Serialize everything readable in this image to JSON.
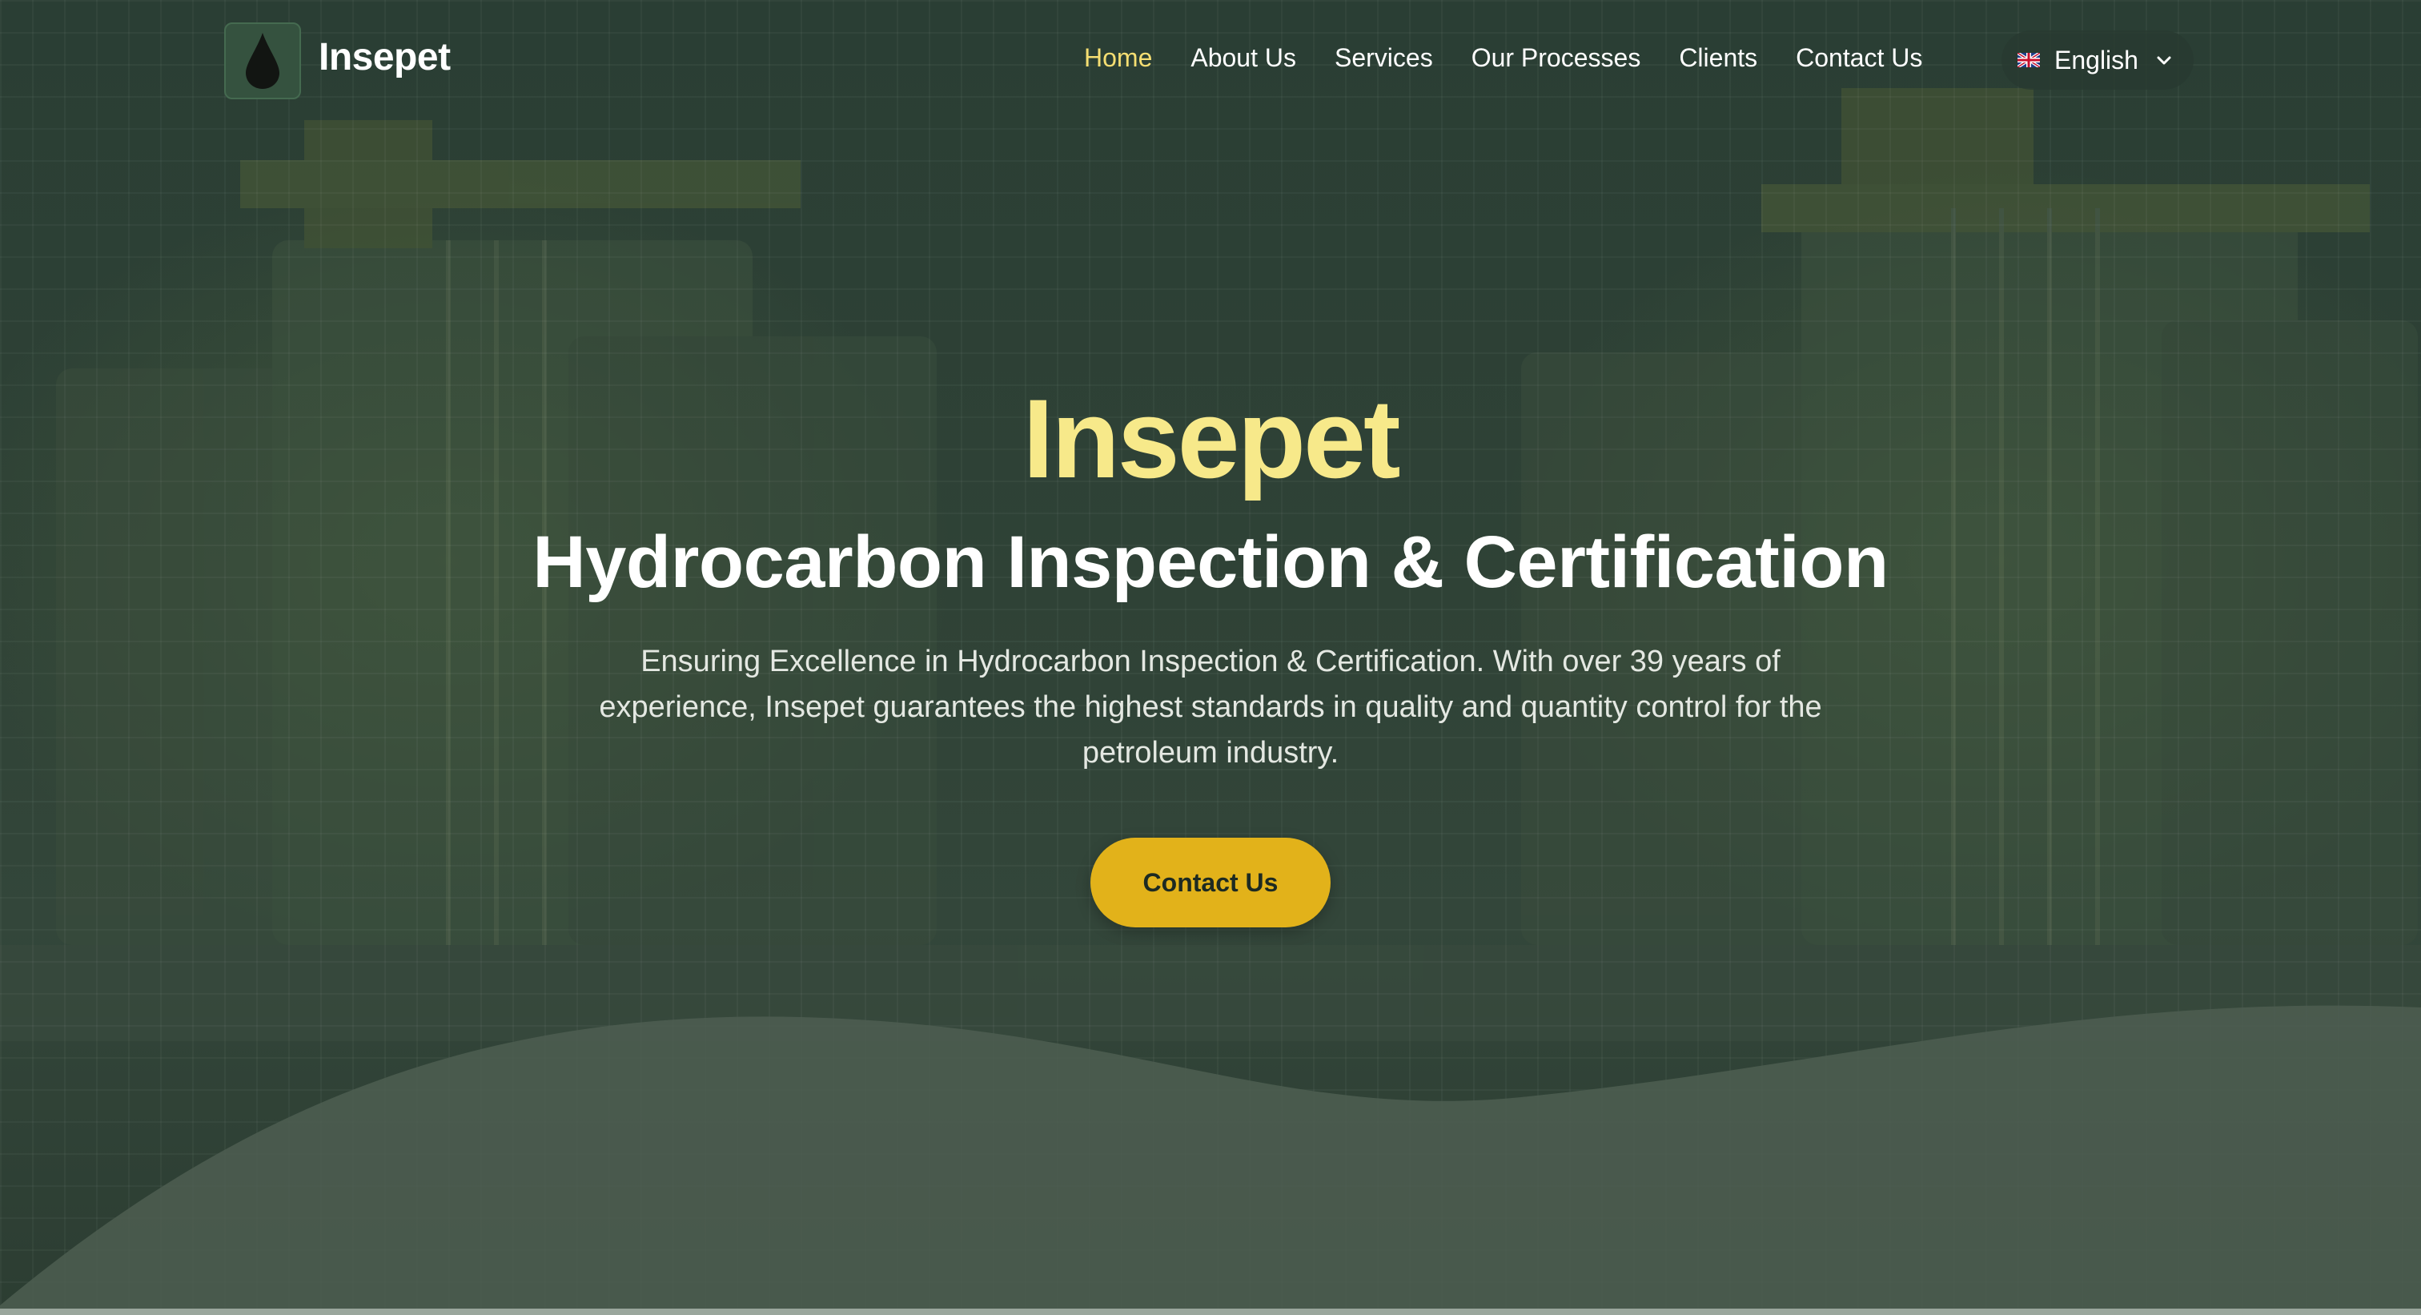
{
  "brand": {
    "name": "Insepet",
    "logo_icon": "oil-drop-icon"
  },
  "nav": {
    "items": [
      {
        "label": "Home",
        "active": true
      },
      {
        "label": "About Us",
        "active": false
      },
      {
        "label": "Services",
        "active": false
      },
      {
        "label": "Our Processes",
        "active": false
      },
      {
        "label": "Clients",
        "active": false
      },
      {
        "label": "Contact Us",
        "active": false
      }
    ]
  },
  "language": {
    "label": "English",
    "flag_icon": "uk-flag-icon",
    "chevron_icon": "chevron-down-icon"
  },
  "hero": {
    "title": "Insepet",
    "subtitle": "Hydrocarbon Inspection & Certification",
    "description": "Ensuring Excellence in Hydrocarbon Inspection & Certification. With over 39 years of experience, Insepet guarantees the highest standards in quality and quantity control for the petroleum industry.",
    "cta_label": "Contact Us"
  },
  "colors": {
    "accent": "#f5de72",
    "cta": "#e2b21a",
    "background": "#2b3a31"
  }
}
